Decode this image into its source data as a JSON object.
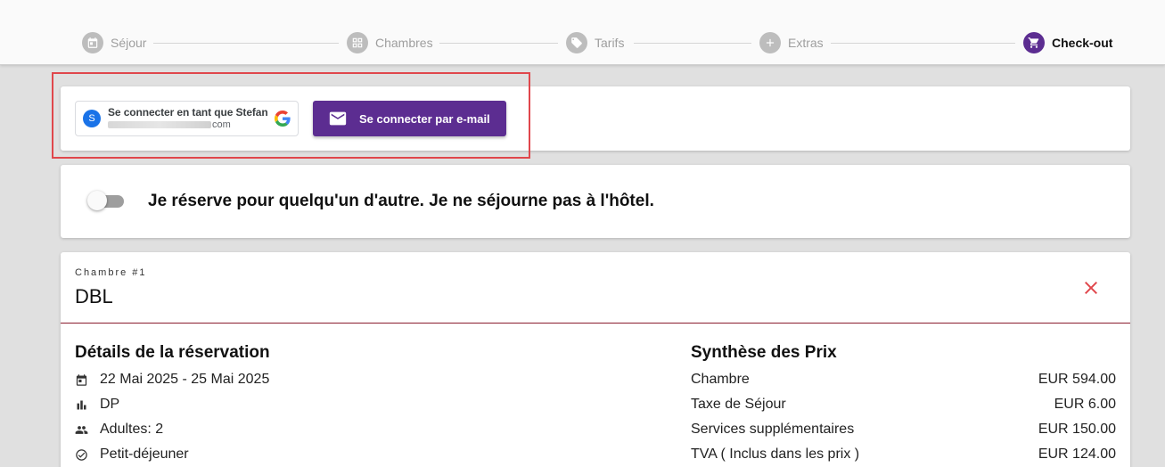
{
  "stepper": {
    "steps": [
      {
        "label": "Séjour",
        "icon": "calendar-icon",
        "active": false
      },
      {
        "label": "Chambres",
        "icon": "grid-icon",
        "active": false
      },
      {
        "label": "Tarifs",
        "icon": "tag-icon",
        "active": false
      },
      {
        "label": "Extras",
        "icon": "plus-icon",
        "active": false
      },
      {
        "label": "Check-out",
        "icon": "cart-icon",
        "active": true
      }
    ],
    "active_color": "#5c2d91"
  },
  "login": {
    "google": {
      "avatar_initial": "S",
      "label": "Se connecter en tant que Stefan",
      "email_suffix": "com"
    },
    "email_button_label": "Se connecter par e-mail"
  },
  "booking_toggle": {
    "label": "Je réserve pour quelqu'un d'autre. Je ne séjourne pas à l'hôtel.",
    "checked": false
  },
  "room": {
    "kicker": "Chambre #1",
    "title": "DBL",
    "details": {
      "heading": "Détails de la réservation",
      "rows": [
        {
          "icon": "calendar-icon",
          "text": "22 Mai 2025 - 25 Mai 2025"
        },
        {
          "icon": "bar-chart-icon",
          "text": "DP"
        },
        {
          "icon": "people-icon",
          "text": "Adultes: 2"
        },
        {
          "icon": "check-circle-icon",
          "text": "Petit-déjeuner"
        }
      ]
    },
    "prices": {
      "heading": "Synthèse des Prix",
      "rows": [
        {
          "label": "Chambre",
          "value": "EUR 594.00"
        },
        {
          "label": "Taxe de Séjour",
          "value": "EUR 6.00"
        },
        {
          "label": "Services supplémentaires",
          "value": "EUR 150.00"
        },
        {
          "label": "TVA ( Inclus dans les prix )",
          "value": "EUR 124.00"
        }
      ]
    }
  },
  "colors": {
    "primary": "#5c2d91",
    "danger": "#e0474c",
    "highlight_box": "#e0474c"
  }
}
